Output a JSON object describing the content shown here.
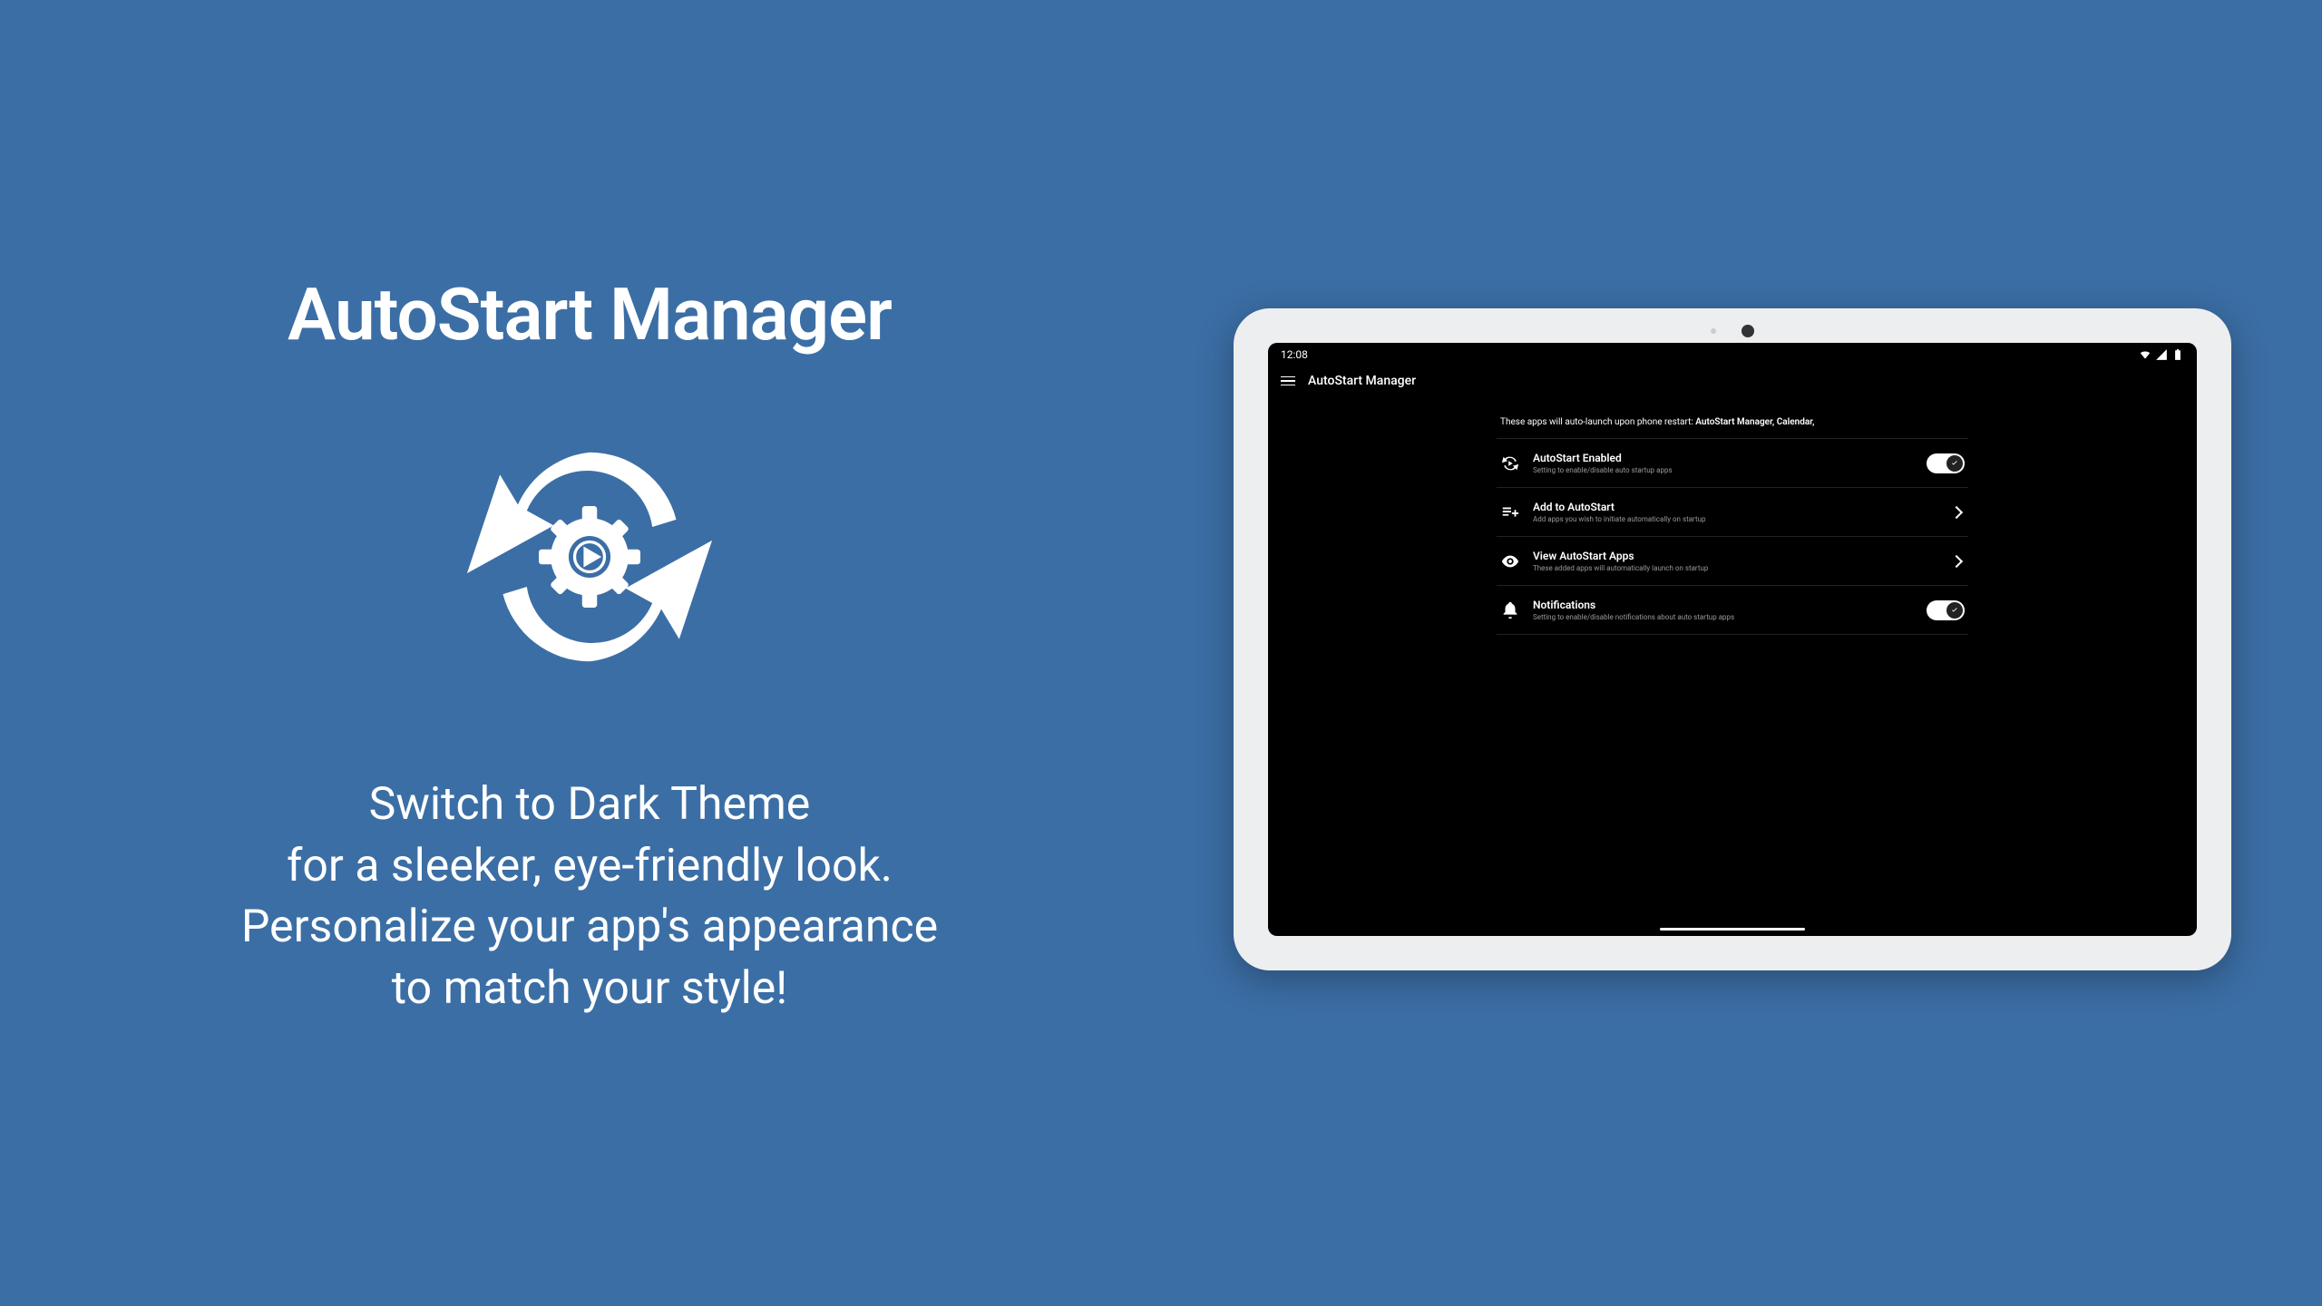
{
  "left": {
    "title": "AutoStart Manager",
    "description_lines": [
      "Switch to Dark Theme",
      "for a sleeker, eye-friendly look.",
      "Personalize your app's appearance",
      "to match your style!"
    ]
  },
  "device": {
    "status_time": "12:08",
    "app_bar_title": "AutoStart Manager",
    "hint_prefix": "These apps will auto-launch upon phone restart: ",
    "hint_bold": "AutoStart Manager, Calendar,",
    "rows": [
      {
        "icon": "sync",
        "title": "AutoStart Enabled",
        "sub": "Setting to enable/disable auto startup apps",
        "trailing": "toggle"
      },
      {
        "icon": "list-plus",
        "title": "Add to AutoStart",
        "sub": "Add apps you wish to initiate automatically on startup",
        "trailing": "chevron"
      },
      {
        "icon": "eye",
        "title": "View AutoStart Apps",
        "sub": "These added apps will automatically launch on startup",
        "trailing": "chevron"
      },
      {
        "icon": "bell",
        "title": "Notifications",
        "sub": "Setting to enable/disable notifications about auto startup apps",
        "trailing": "toggle"
      }
    ]
  }
}
